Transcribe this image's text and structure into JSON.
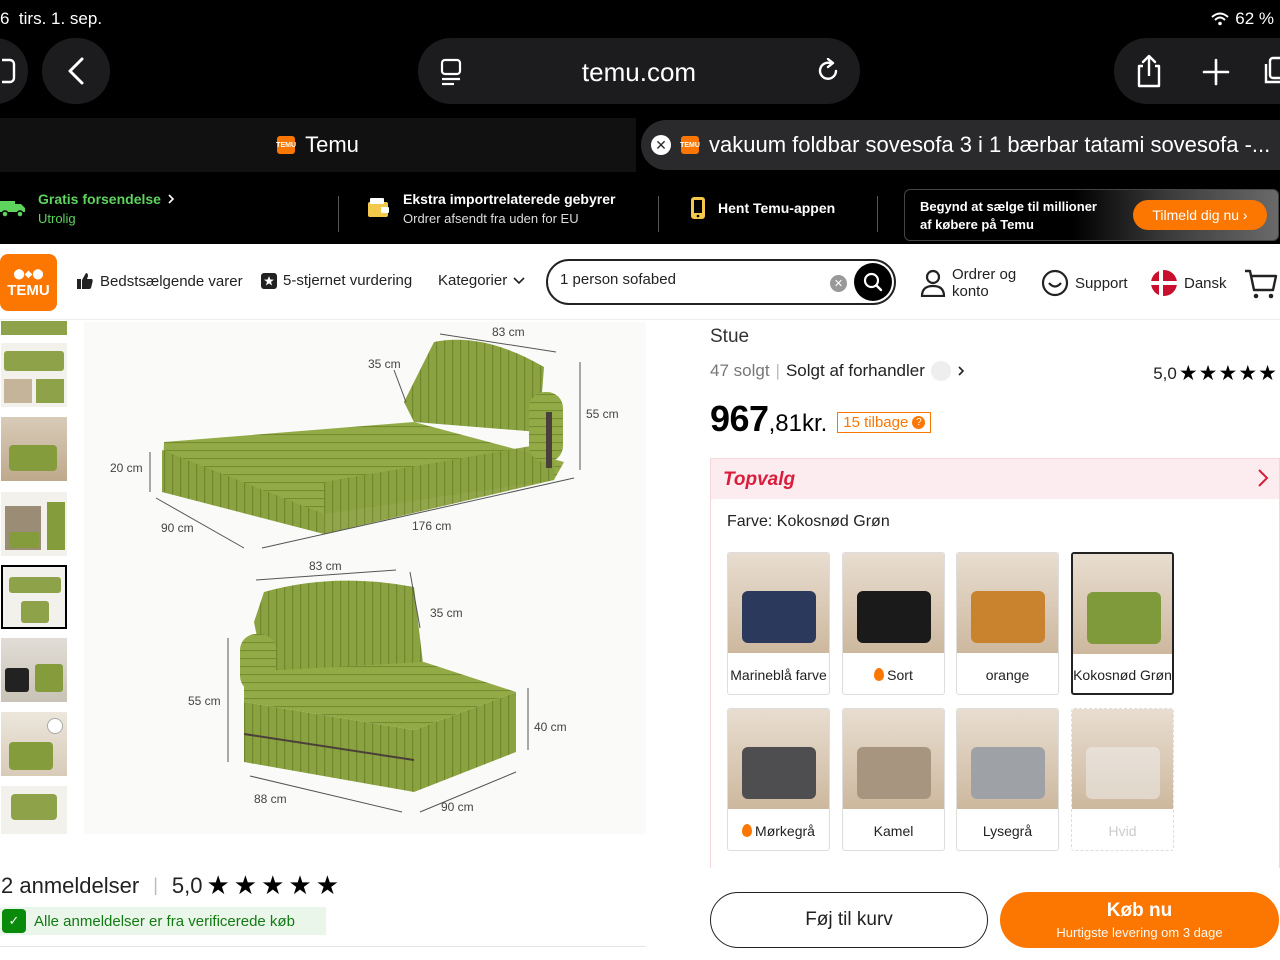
{
  "status": {
    "time": "6",
    "date": "tirs. 1. sep.",
    "battery": "62 %"
  },
  "browser": {
    "url": "temu.com",
    "tabs": [
      {
        "label": "Temu"
      },
      {
        "label": "vakuum foldbar sovesofa 3 i 1 bærbar tatami sovesofa -..."
      }
    ]
  },
  "promo": {
    "shipping_title": "Gratis forsendelse",
    "shipping_sub": "Utrolig",
    "import_title": "Ekstra importrelaterede gebyrer",
    "import_sub": "Ordrer afsendt fra uden for EU",
    "app_title": "Hent Temu-appen",
    "seller_text_1": "Begynd at sælge til millioner",
    "seller_text_2": "af købere på Temu",
    "seller_btn": "Tilmeld dig nu"
  },
  "nav": {
    "logo_line1": "TEMU",
    "bestsellers": "Bedstsælgende varer",
    "five_star": "5-stjernet vurdering",
    "categories": "Kategorier",
    "search_value": "1 person sofabed",
    "orders_1": "Ordrer og",
    "orders_2": "konto",
    "support": "Support",
    "language": "Dansk"
  },
  "image_dims": {
    "top_width": "83 cm",
    "top_back_height": "35 cm",
    "top_side_height": "55 cm",
    "top_seat_height": "20 cm",
    "top_depth": "90 cm",
    "top_length": "176 cm",
    "bottom_width": "83 cm",
    "bottom_back": "35 cm",
    "bottom_total": "55 cm",
    "bottom_seat": "40 cm",
    "bottom_left": "88 cm",
    "bottom_right": "90 cm"
  },
  "reviews": {
    "title": "2 anmeldelser",
    "score": "5,0",
    "verified": "Alle anmeldelser er fra verificerede køb"
  },
  "product": {
    "breadcrumb": "Stue",
    "sold": "47 solgt",
    "seller": "Solgt af forhandler",
    "rating": "5,0",
    "price_main": "967",
    "price_rest": ",81kr.",
    "badge": "15 tilbage",
    "topvalg": "Topvalg",
    "color_label": "Farve: Kokosnød Grøn",
    "swatches": [
      {
        "label": "Marineblå farve",
        "color": "#2b3a5c"
      },
      {
        "label": "Sort",
        "color": "#1a1a1a"
      },
      {
        "label": "orange",
        "color": "#c9822e"
      },
      {
        "label": "Kokosnød Grøn",
        "color": "#7f9a3a"
      },
      {
        "label": "Mørkegrå",
        "color": "#4e4e50"
      },
      {
        "label": "Kamel",
        "color": "#a89580"
      },
      {
        "label": "Lysegrå",
        "color": "#9ea1a6"
      },
      {
        "label": "Hvid",
        "color": "#f2f2f2"
      }
    ]
  },
  "buttons": {
    "cart": "Føj til kurv",
    "buy": "Køb nu",
    "buy_sub": "Hurtigste levering om 3 dage"
  },
  "colors": {
    "accent": "#fb7701",
    "green": "#7f9a3a",
    "topvalg_red": "#d81e3c"
  }
}
